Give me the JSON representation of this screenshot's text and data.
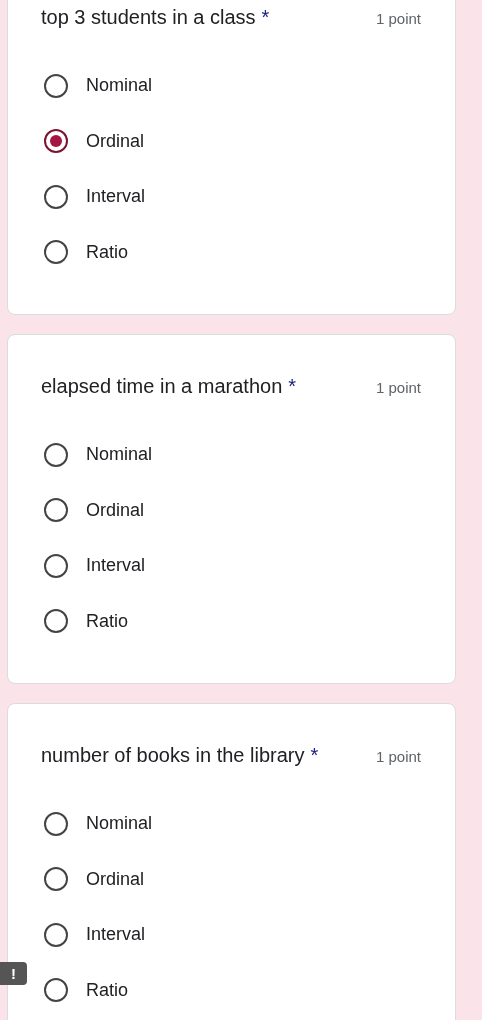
{
  "questions": [
    {
      "title": "top 3 students in a class",
      "required_mark": "*",
      "points": "1 point",
      "options": [
        {
          "label": "Nominal",
          "selected": false
        },
        {
          "label": "Ordinal",
          "selected": true
        },
        {
          "label": "Interval",
          "selected": false
        },
        {
          "label": "Ratio",
          "selected": false
        }
      ]
    },
    {
      "title": "elapsed time in a marathon",
      "required_mark": "*",
      "points": "1 point",
      "options": [
        {
          "label": "Nominal",
          "selected": false
        },
        {
          "label": "Ordinal",
          "selected": false
        },
        {
          "label": "Interval",
          "selected": false
        },
        {
          "label": "Ratio",
          "selected": false
        }
      ]
    },
    {
      "title": "number of books in the library",
      "required_mark": "*",
      "points": "1 point",
      "options": [
        {
          "label": "Nominal",
          "selected": false
        },
        {
          "label": "Ordinal",
          "selected": false
        },
        {
          "label": "Interval",
          "selected": false
        },
        {
          "label": "Ratio",
          "selected": false
        }
      ]
    }
  ],
  "feedback_badge": "!"
}
